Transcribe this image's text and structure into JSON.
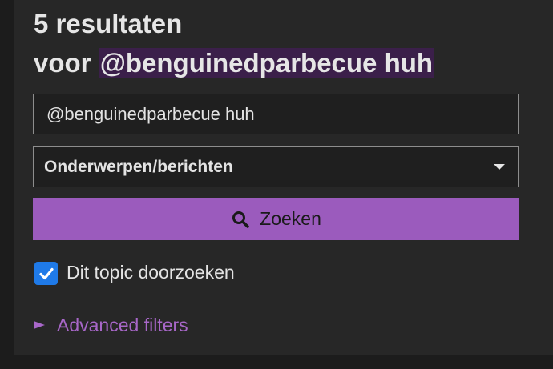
{
  "results": {
    "count_line": "5 resultaten",
    "for_prefix": "voor",
    "query_highlight": "@benguinedparbecue huh"
  },
  "search": {
    "value": "@benguinedparbecue huh",
    "scope_selected": "Onderwerpen/berichten",
    "button_label": "Zoeken",
    "button_icon": "search-icon"
  },
  "options": {
    "this_topic_label": "Dit topic doorzoeken",
    "this_topic_checked": true,
    "advanced_label": "Advanced filters"
  },
  "colors": {
    "accent": "#9b5bbd",
    "link": "#a867c9",
    "checkbox": "#1f7ae8",
    "highlight_bg": "#3b1f4a"
  }
}
